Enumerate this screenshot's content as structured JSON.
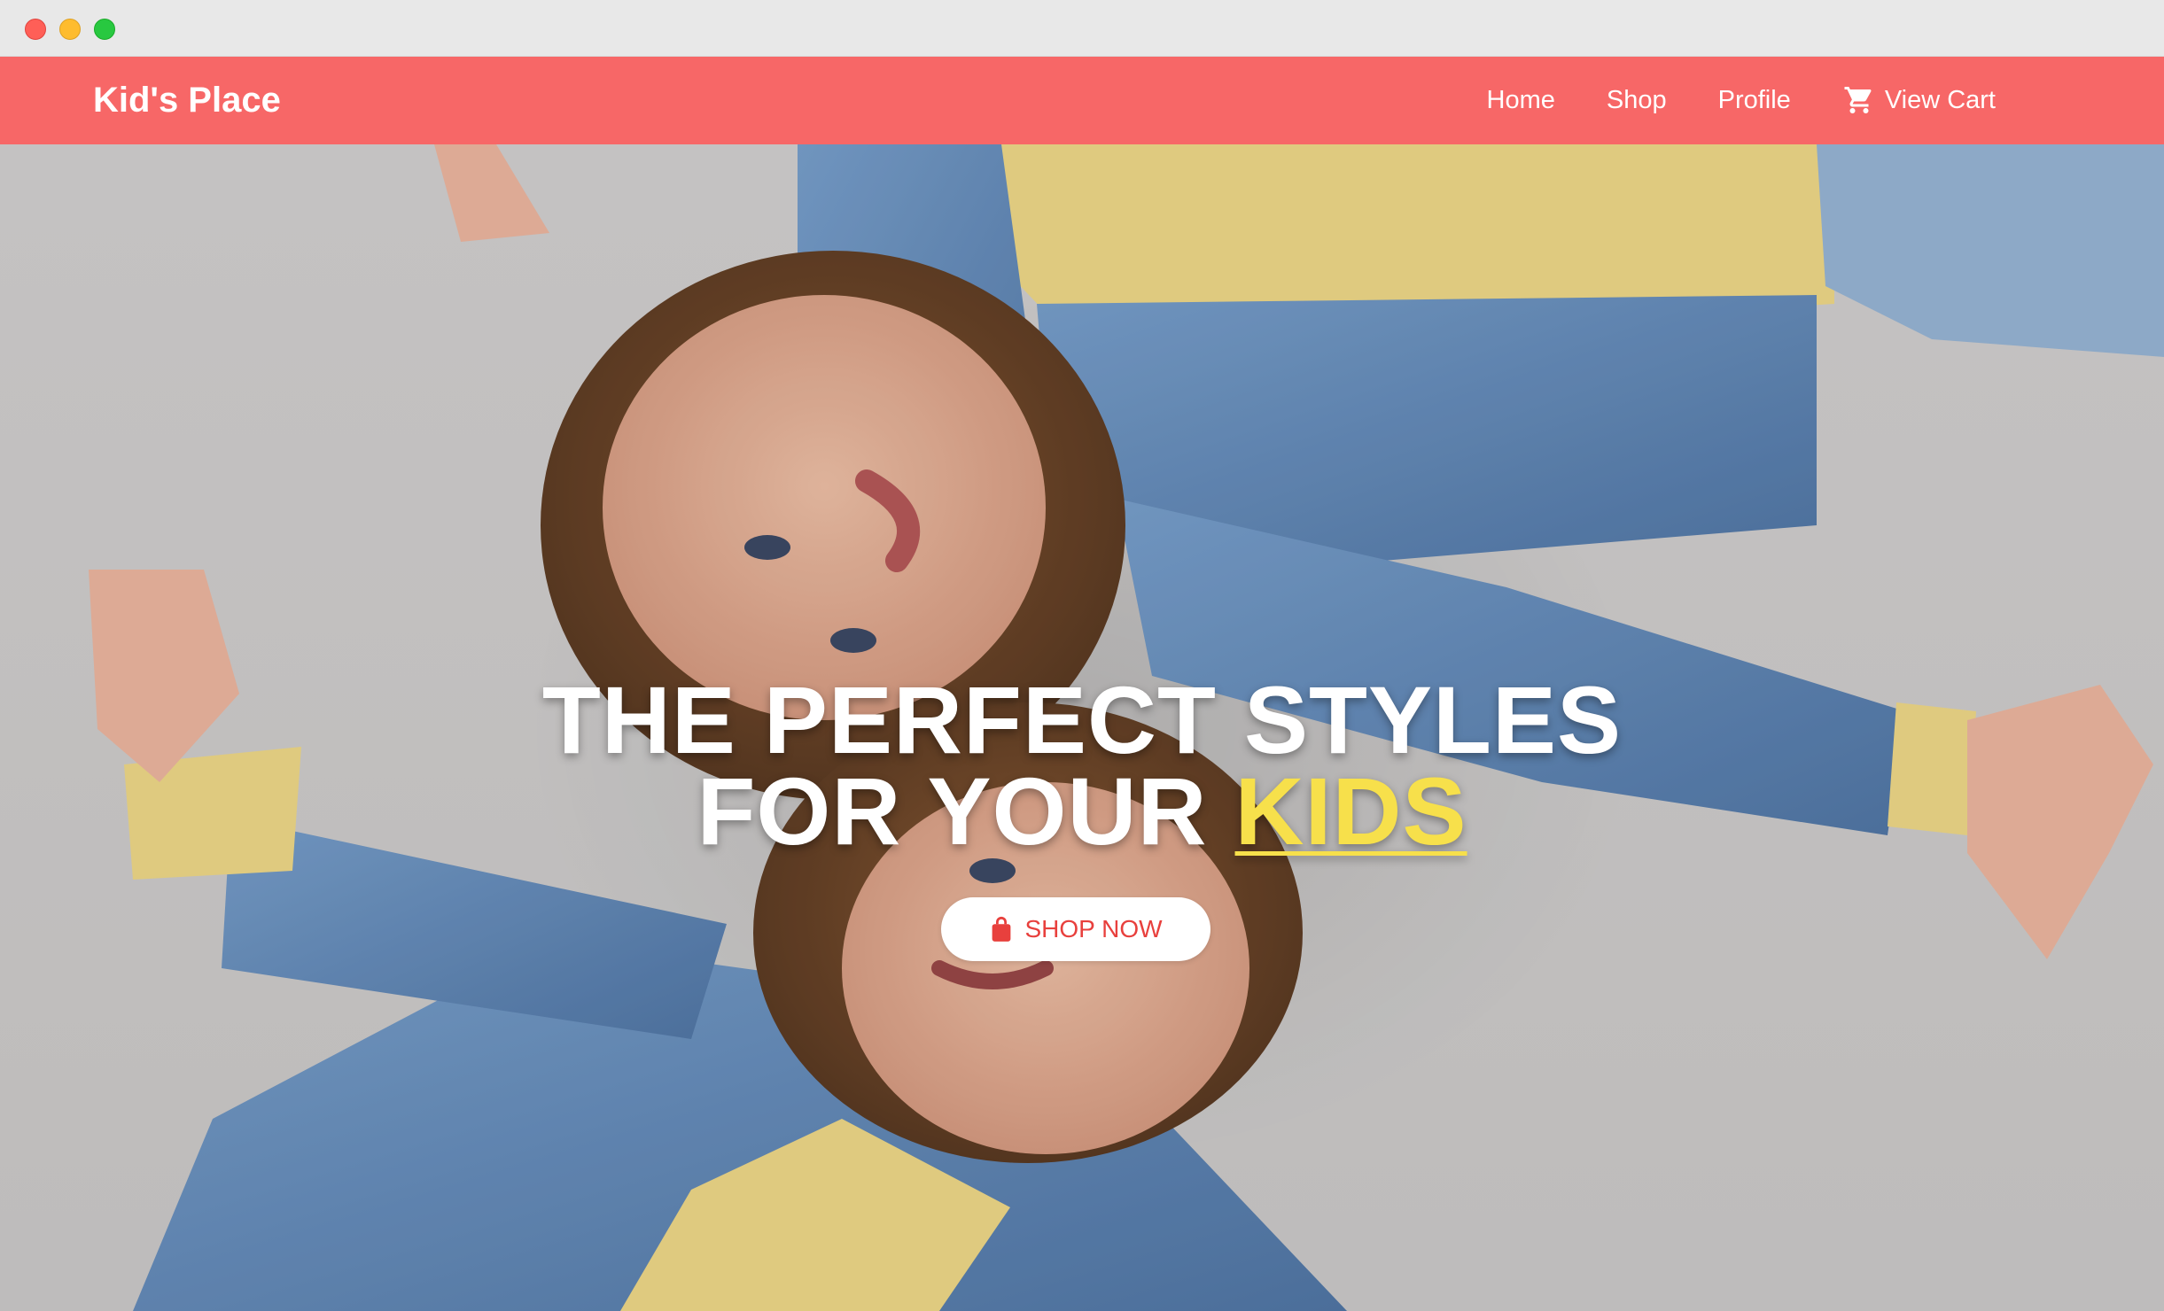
{
  "window": {
    "controls": [
      "close",
      "minimize",
      "maximize"
    ]
  },
  "navbar": {
    "brand": "Kid's Place",
    "background_color": "#f76767",
    "links": [
      {
        "label": "Home"
      },
      {
        "label": "Shop"
      },
      {
        "label": "Profile"
      },
      {
        "label": "View Cart",
        "icon": "cart-icon"
      }
    ]
  },
  "hero": {
    "headline_line1": "THE PERFECT STYLES",
    "headline_line2_prefix": "FOR YOUR ",
    "headline_highlight": "KIDS",
    "highlight_color": "#f7e04b",
    "button": {
      "label": "SHOP NOW",
      "icon": "shopping-bag-icon",
      "text_color": "#e8403d"
    }
  }
}
